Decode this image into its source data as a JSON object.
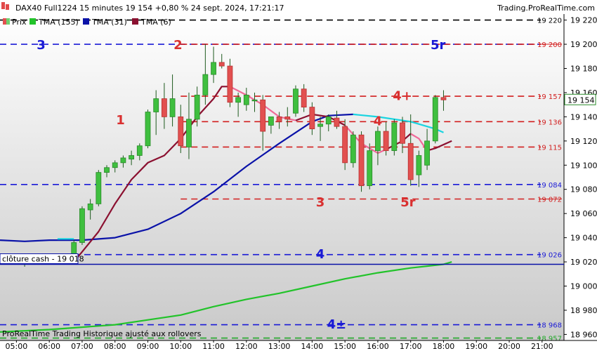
{
  "header": {
    "title": "DAX40 Full1224 15 minutes 19 154 +0,80 % 24 sept. 2024, 17:21:17",
    "watermark": "Trading.ProRealTime.com"
  },
  "legend": [
    {
      "label": "Prix",
      "color": "#6fcf6f",
      "marker": "candle-icon"
    },
    {
      "label": "TMA (155)",
      "color": "#22c32a",
      "marker": "square"
    },
    {
      "label": "TMA (31)",
      "color": "#0a12a8",
      "marker": "square"
    },
    {
      "label": "TMA (6)",
      "color": "#8b1030",
      "marker": "square"
    }
  ],
  "footer": {
    "text": "ProRealTime Trading  Historique ajusté aux rollovers"
  },
  "close_cash": {
    "label": "clôture cash -  19 018",
    "value": 19018,
    "color": "#0a12a8"
  },
  "current_price": {
    "label": "19 154",
    "value": 19154
  },
  "chart_data": {
    "type": "candlestick",
    "timeframe": "15 minutes",
    "ylim": [
      18955,
      19225
    ],
    "xlim": [
      "04:30",
      "21:40"
    ],
    "y_ticks": [
      {
        "value": 19220,
        "label": "19 220"
      },
      {
        "value": 19200,
        "label": "19 200"
      },
      {
        "value": 19180,
        "label": "19 180"
      },
      {
        "value": 19160,
        "label": "19 160"
      },
      {
        "value": 19140,
        "label": "19 140"
      },
      {
        "value": 19120,
        "label": "19 120"
      },
      {
        "value": 19100,
        "label": "19 100"
      },
      {
        "value": 19080,
        "label": "19 080"
      },
      {
        "value": 19060,
        "label": "19 060"
      },
      {
        "value": 19040,
        "label": "19 040"
      },
      {
        "value": 19020,
        "label": "19 020"
      },
      {
        "value": 19000,
        "label": "19 000"
      },
      {
        "value": 18980,
        "label": "18 980"
      },
      {
        "value": 18960,
        "label": "18 960"
      }
    ],
    "x_ticks": [
      "05:00",
      "06:00",
      "07:00",
      "08:00",
      "09:00",
      "10:00",
      "11:00",
      "12:00",
      "13:00",
      "14:00",
      "15:00",
      "16:00",
      "17:00",
      "18:00",
      "19:00",
      "20:00",
      "21:00"
    ],
    "levels": [
      {
        "value": 19220,
        "label": "19 220",
        "color": "#000000",
        "label_color": "#000000",
        "label_bg": "#ffffff"
      },
      {
        "value": 19200,
        "label": "19 200",
        "color": "#1a1ad6",
        "label_color": "#d21e1e",
        "label_bg": "#ffffff",
        "strike": true
      },
      {
        "value": 19200,
        "label": "",
        "color": "#d21e1e",
        "label_color": "#d21e1e",
        "from": "10:00"
      },
      {
        "value": 19157,
        "label": "19 157",
        "color": "#d21e1e",
        "label_color": "#d21e1e",
        "from": "10:00"
      },
      {
        "value": 19136,
        "label": "19 136",
        "color": "#d21e1e",
        "label_color": "#d21e1e",
        "from": "10:00"
      },
      {
        "value": 19115,
        "label": "19 115",
        "color": "#d21e1e",
        "label_color": "#d21e1e",
        "from": "10:00"
      },
      {
        "value": 19084,
        "label": "19 084",
        "color": "#1a1ad6",
        "label_color": "#1a1ad6"
      },
      {
        "value": 19072,
        "label": "19 072",
        "color": "#d21e1e",
        "label_color": "#d21e1e",
        "from": "10:00",
        "strike": true
      },
      {
        "value": 19026,
        "label": "19 026",
        "color": "#1a1ad6",
        "label_color": "#1a1ad6"
      },
      {
        "value": 18968,
        "label": "18 968",
        "color": "#1a1ad6",
        "label_color": "#1a1ad6"
      },
      {
        "value": 18957,
        "label": "18 957",
        "color": "#22a82a",
        "label_color": "#22a82a"
      }
    ],
    "annotations": [
      {
        "text": "3",
        "time": "05:45",
        "value": 19200,
        "color": "#1a1ad6"
      },
      {
        "text": "2",
        "time": "09:55",
        "value": 19200,
        "color": "#d93030"
      },
      {
        "text": "5r",
        "time": "17:50",
        "value": 19200,
        "color": "#1a1ad6"
      },
      {
        "text": "1",
        "time": "08:10",
        "value": 19138,
        "color": "#d93030"
      },
      {
        "text": "4+",
        "time": "16:45",
        "value": 19158,
        "color": "#d93030"
      },
      {
        "text": "4",
        "time": "16:00",
        "value": 19137,
        "color": "#d93030"
      },
      {
        "text": "3",
        "time": "14:15",
        "value": 19070,
        "color": "#d93030"
      },
      {
        "text": "5r",
        "time": "16:55",
        "value": 19070,
        "color": "#d93030"
      },
      {
        "text": "4",
        "time": "14:15",
        "value": 19027,
        "color": "#1a1ad6"
      },
      {
        "text": "4±",
        "time": "14:45",
        "value": 18969,
        "color": "#1a1ad6"
      }
    ],
    "candles": [
      {
        "t": "05:15",
        "o": 19020,
        "h": 19023,
        "l": 19016,
        "c": 19018
      },
      {
        "t": "06:30",
        "o": 19021,
        "h": 19025,
        "l": 19019,
        "c": 19022
      },
      {
        "t": "06:45",
        "o": 19022,
        "h": 19038,
        "l": 19020,
        "c": 19036
      },
      {
        "t": "07:00",
        "o": 19036,
        "h": 19066,
        "l": 19034,
        "c": 19064
      },
      {
        "t": "07:15",
        "o": 19063,
        "h": 19072,
        "l": 19055,
        "c": 19068
      },
      {
        "t": "07:30",
        "o": 19068,
        "h": 19096,
        "l": 19066,
        "c": 19094
      },
      {
        "t": "07:45",
        "o": 19094,
        "h": 19100,
        "l": 19090,
        "c": 19098
      },
      {
        "t": "08:00",
        "o": 19098,
        "h": 19104,
        "l": 19094,
        "c": 19102
      },
      {
        "t": "08:15",
        "o": 19102,
        "h": 19108,
        "l": 19098,
        "c": 19106
      },
      {
        "t": "08:30",
        "o": 19105,
        "h": 19112,
        "l": 19100,
        "c": 19108
      },
      {
        "t": "08:45",
        "o": 19108,
        "h": 19118,
        "l": 19104,
        "c": 19116
      },
      {
        "t": "09:00",
        "o": 19116,
        "h": 19146,
        "l": 19114,
        "c": 19144
      },
      {
        "t": "09:15",
        "o": 19144,
        "h": 19162,
        "l": 19125,
        "c": 19155
      },
      {
        "t": "09:30",
        "o": 19155,
        "h": 19168,
        "l": 19130,
        "c": 19140
      },
      {
        "t": "09:45",
        "o": 19140,
        "h": 19175,
        "l": 19132,
        "c": 19155
      },
      {
        "t": "10:00",
        "o": 19140,
        "h": 19150,
        "l": 19110,
        "c": 19116
      },
      {
        "t": "10:15",
        "o": 19115,
        "h": 19160,
        "l": 19105,
        "c": 19138
      },
      {
        "t": "10:30",
        "o": 19138,
        "h": 19165,
        "l": 19132,
        "c": 19158
      },
      {
        "t": "10:45",
        "o": 19158,
        "h": 19200,
        "l": 19150,
        "c": 19175
      },
      {
        "t": "11:00",
        "o": 19175,
        "h": 19198,
        "l": 19168,
        "c": 19185
      },
      {
        "t": "11:15",
        "o": 19185,
        "h": 19192,
        "l": 19180,
        "c": 19182
      },
      {
        "t": "11:30",
        "o": 19182,
        "h": 19188,
        "l": 19148,
        "c": 19152
      },
      {
        "t": "11:45",
        "o": 19152,
        "h": 19160,
        "l": 19140,
        "c": 19156
      },
      {
        "t": "12:00",
        "o": 19150,
        "h": 19164,
        "l": 19145,
        "c": 19158
      },
      {
        "t": "12:15",
        "o": 19154,
        "h": 19160,
        "l": 19144,
        "c": 19154
      },
      {
        "t": "12:30",
        "o": 19154,
        "h": 19158,
        "l": 19112,
        "c": 19128
      },
      {
        "t": "12:45",
        "o": 19133,
        "h": 19140,
        "l": 19126,
        "c": 19140
      },
      {
        "t": "13:00",
        "o": 19140,
        "h": 19144,
        "l": 19130,
        "c": 19136
      },
      {
        "t": "13:15",
        "o": 19140,
        "h": 19148,
        "l": 19132,
        "c": 19138
      },
      {
        "t": "13:30",
        "o": 19143,
        "h": 19166,
        "l": 19140,
        "c": 19163
      },
      {
        "t": "13:45",
        "o": 19163,
        "h": 19167,
        "l": 19144,
        "c": 19148
      },
      {
        "t": "14:00",
        "o": 19148,
        "h": 19152,
        "l": 19125,
        "c": 19130
      },
      {
        "t": "14:15",
        "o": 19132,
        "h": 19140,
        "l": 19120,
        "c": 19134
      },
      {
        "t": "14:30",
        "o": 19134,
        "h": 19142,
        "l": 19128,
        "c": 19140
      },
      {
        "t": "14:45",
        "o": 19139,
        "h": 19145,
        "l": 19130,
        "c": 19132
      },
      {
        "t": "15:00",
        "o": 19132,
        "h": 19138,
        "l": 19096,
        "c": 19102
      },
      {
        "t": "15:15",
        "o": 19102,
        "h": 19128,
        "l": 19098,
        "c": 19125
      },
      {
        "t": "15:30",
        "o": 19125,
        "h": 19128,
        "l": 19078,
        "c": 19083
      },
      {
        "t": "15:45",
        "o": 19083,
        "h": 19118,
        "l": 19080,
        "c": 19112
      },
      {
        "t": "16:00",
        "o": 19112,
        "h": 19132,
        "l": 19100,
        "c": 19128
      },
      {
        "t": "16:15",
        "o": 19128,
        "h": 19136,
        "l": 19108,
        "c": 19112
      },
      {
        "t": "16:30",
        "o": 19112,
        "h": 19138,
        "l": 19108,
        "c": 19135
      },
      {
        "t": "16:45",
        "o": 19135,
        "h": 19140,
        "l": 19110,
        "c": 19118
      },
      {
        "t": "17:00",
        "o": 19118,
        "h": 19142,
        "l": 19083,
        "c": 19088
      },
      {
        "t": "17:15",
        "o": 19092,
        "h": 19112,
        "l": 19082,
        "c": 19108
      },
      {
        "t": "17:30",
        "o": 19100,
        "h": 19130,
        "l": 19096,
        "c": 19120
      },
      {
        "t": "17:45",
        "o": 19120,
        "h": 19158,
        "l": 19118,
        "c": 19156
      },
      {
        "t": "18:00",
        "o": 19156,
        "h": 19162,
        "l": 19145,
        "c": 19154
      }
    ],
    "series": [
      {
        "name": "TMA (155)",
        "color": "#22c32a",
        "points": [
          [
            "04:30",
            18962
          ],
          [
            "06:00",
            18964
          ],
          [
            "08:00",
            18968
          ],
          [
            "09:00",
            18972
          ],
          [
            "10:00",
            18976
          ],
          [
            "11:00",
            18983
          ],
          [
            "12:00",
            18989
          ],
          [
            "13:00",
            18994
          ],
          [
            "14:00",
            19000
          ],
          [
            "15:00",
            19006
          ],
          [
            "16:00",
            19011
          ],
          [
            "17:00",
            19015
          ],
          [
            "18:00",
            19018
          ],
          [
            "18:15",
            19020
          ]
        ]
      },
      {
        "name": "TMA (31)",
        "color": "#0a12a8",
        "points": [
          [
            "04:30",
            19038
          ],
          [
            "05:15",
            19037
          ],
          [
            "06:00",
            19038
          ],
          [
            "07:00",
            19038
          ],
          [
            "08:00",
            19040
          ],
          [
            "09:00",
            19047
          ],
          [
            "10:00",
            19060
          ],
          [
            "11:00",
            19078
          ],
          [
            "12:00",
            19099
          ],
          [
            "13:00",
            19118
          ],
          [
            "14:00",
            19136
          ],
          [
            "14:30",
            19141
          ],
          [
            "15:15",
            19142
          ]
        ]
      },
      {
        "name": "TMA (31)",
        "color": "#19d4e0",
        "points": [
          [
            "06:15",
            19039
          ],
          [
            "06:45",
            19039
          ]
        ]
      },
      {
        "name": "TMA (31)",
        "color": "#19d4e0",
        "points": [
          [
            "15:15",
            19142
          ],
          [
            "16:00",
            19140
          ],
          [
            "17:00",
            19136
          ],
          [
            "17:45",
            19130
          ],
          [
            "18:00",
            19127
          ]
        ]
      },
      {
        "name": "TMA (6)",
        "color": "#8b1030",
        "points": [
          [
            "06:45",
            19020
          ],
          [
            "07:30",
            19045
          ],
          [
            "08:00",
            19068
          ],
          [
            "08:30",
            19088
          ],
          [
            "09:00",
            19102
          ],
          [
            "09:30",
            19108
          ],
          [
            "10:00",
            19122
          ],
          [
            "10:30",
            19140
          ],
          [
            "11:00",
            19155
          ],
          [
            "11:15",
            19165
          ],
          [
            "11:30",
            19165
          ]
        ]
      },
      {
        "name": "TMA (6)",
        "color": "#f06a98",
        "points": [
          [
            "11:30",
            19165
          ],
          [
            "12:00",
            19158
          ],
          [
            "12:30",
            19150
          ],
          [
            "13:00",
            19140
          ],
          [
            "13:30",
            19137
          ]
        ]
      },
      {
        "name": "TMA (6)",
        "color": "#8b1030",
        "points": [
          [
            "13:30",
            19137
          ],
          [
            "14:00",
            19142
          ],
          [
            "14:30",
            19140
          ],
          [
            "15:00",
            19133
          ]
        ]
      },
      {
        "name": "TMA (6)",
        "color": "#f06a98",
        "points": [
          [
            "15:00",
            19133
          ],
          [
            "15:30",
            19118
          ],
          [
            "16:00",
            19110
          ],
          [
            "16:15",
            19113
          ]
        ]
      },
      {
        "name": "TMA (6)",
        "color": "#8b1030",
        "points": [
          [
            "16:15",
            19113
          ],
          [
            "16:45",
            19120
          ],
          [
            "17:00",
            19126
          ]
        ]
      },
      {
        "name": "TMA (6)",
        "color": "#f06a98",
        "points": [
          [
            "17:00",
            19126
          ],
          [
            "17:15",
            19122
          ],
          [
            "17:30",
            19112
          ]
        ]
      },
      {
        "name": "TMA (6)",
        "color": "#8b1030",
        "points": [
          [
            "17:30",
            19112
          ],
          [
            "17:45",
            19114
          ],
          [
            "18:15",
            19120
          ]
        ]
      }
    ]
  }
}
